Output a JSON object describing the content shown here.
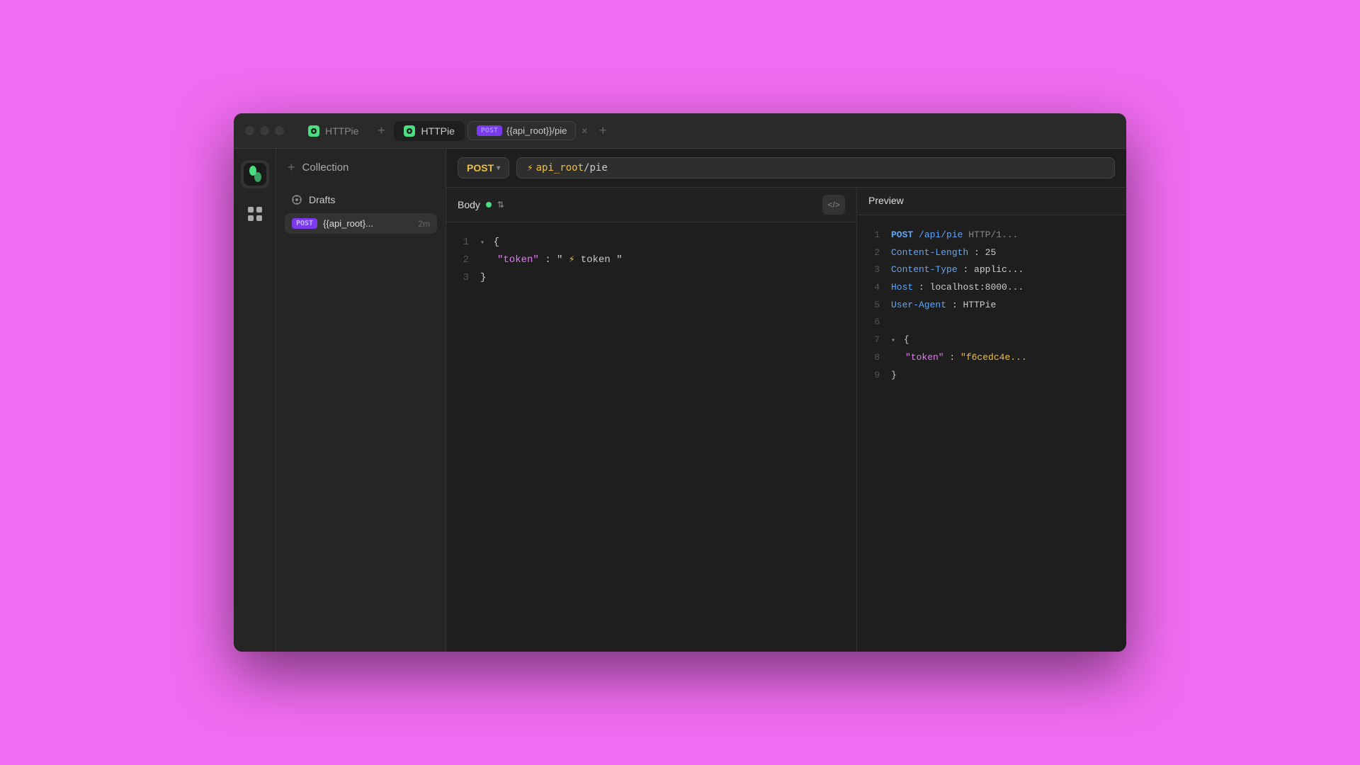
{
  "window": {
    "title": "HTTPie"
  },
  "titlebar": {
    "tab1_label": "HTTPie",
    "tab2_label": "HTTPie",
    "tab2_url": "POST {{api_root}}/pie",
    "add_tab_label": "+",
    "post_badge": "POST",
    "tab_url_display": "{{api_root}}/pie"
  },
  "sidebar": {
    "collection_label": "Collection",
    "add_label": "+",
    "drafts_label": "Drafts",
    "request": {
      "method": "POST",
      "name": "{{api_root}...",
      "time": "2m"
    }
  },
  "url_bar": {
    "method": "POST",
    "bolt": "⚡",
    "variable": "api_root",
    "path": "/pie"
  },
  "body_panel": {
    "title": "Body",
    "code_toggle": "</>",
    "lines": [
      {
        "num": "1",
        "content": "▾ {"
      },
      {
        "num": "2",
        "content": "\"token\": \" ⚡ token \""
      },
      {
        "num": "3",
        "content": "}"
      }
    ]
  },
  "preview_panel": {
    "title": "Preview",
    "lines": [
      {
        "num": "1",
        "content": "POST /api/pie HTTP/1..."
      },
      {
        "num": "2",
        "content": "Content-Length: 25"
      },
      {
        "num": "3",
        "content": "Content-Type: applic..."
      },
      {
        "num": "4",
        "content": "Host: localhost:8000..."
      },
      {
        "num": "5",
        "content": "User-Agent: HTTPie"
      },
      {
        "num": "6",
        "content": ""
      },
      {
        "num": "7",
        "content": "▾ {"
      },
      {
        "num": "8",
        "content": "\"token\": \"f6cedc4e..."
      },
      {
        "num": "9",
        "content": "}"
      }
    ]
  },
  "colors": {
    "background": "#f06cf0",
    "window_bg": "#1e1e1e",
    "sidebar_bg": "#252525",
    "accent_green": "#4ade80",
    "accent_yellow": "#f0c040",
    "accent_purple": "#7c3aed",
    "accent_blue": "#60a5fa",
    "accent_pink": "#e879f9"
  }
}
